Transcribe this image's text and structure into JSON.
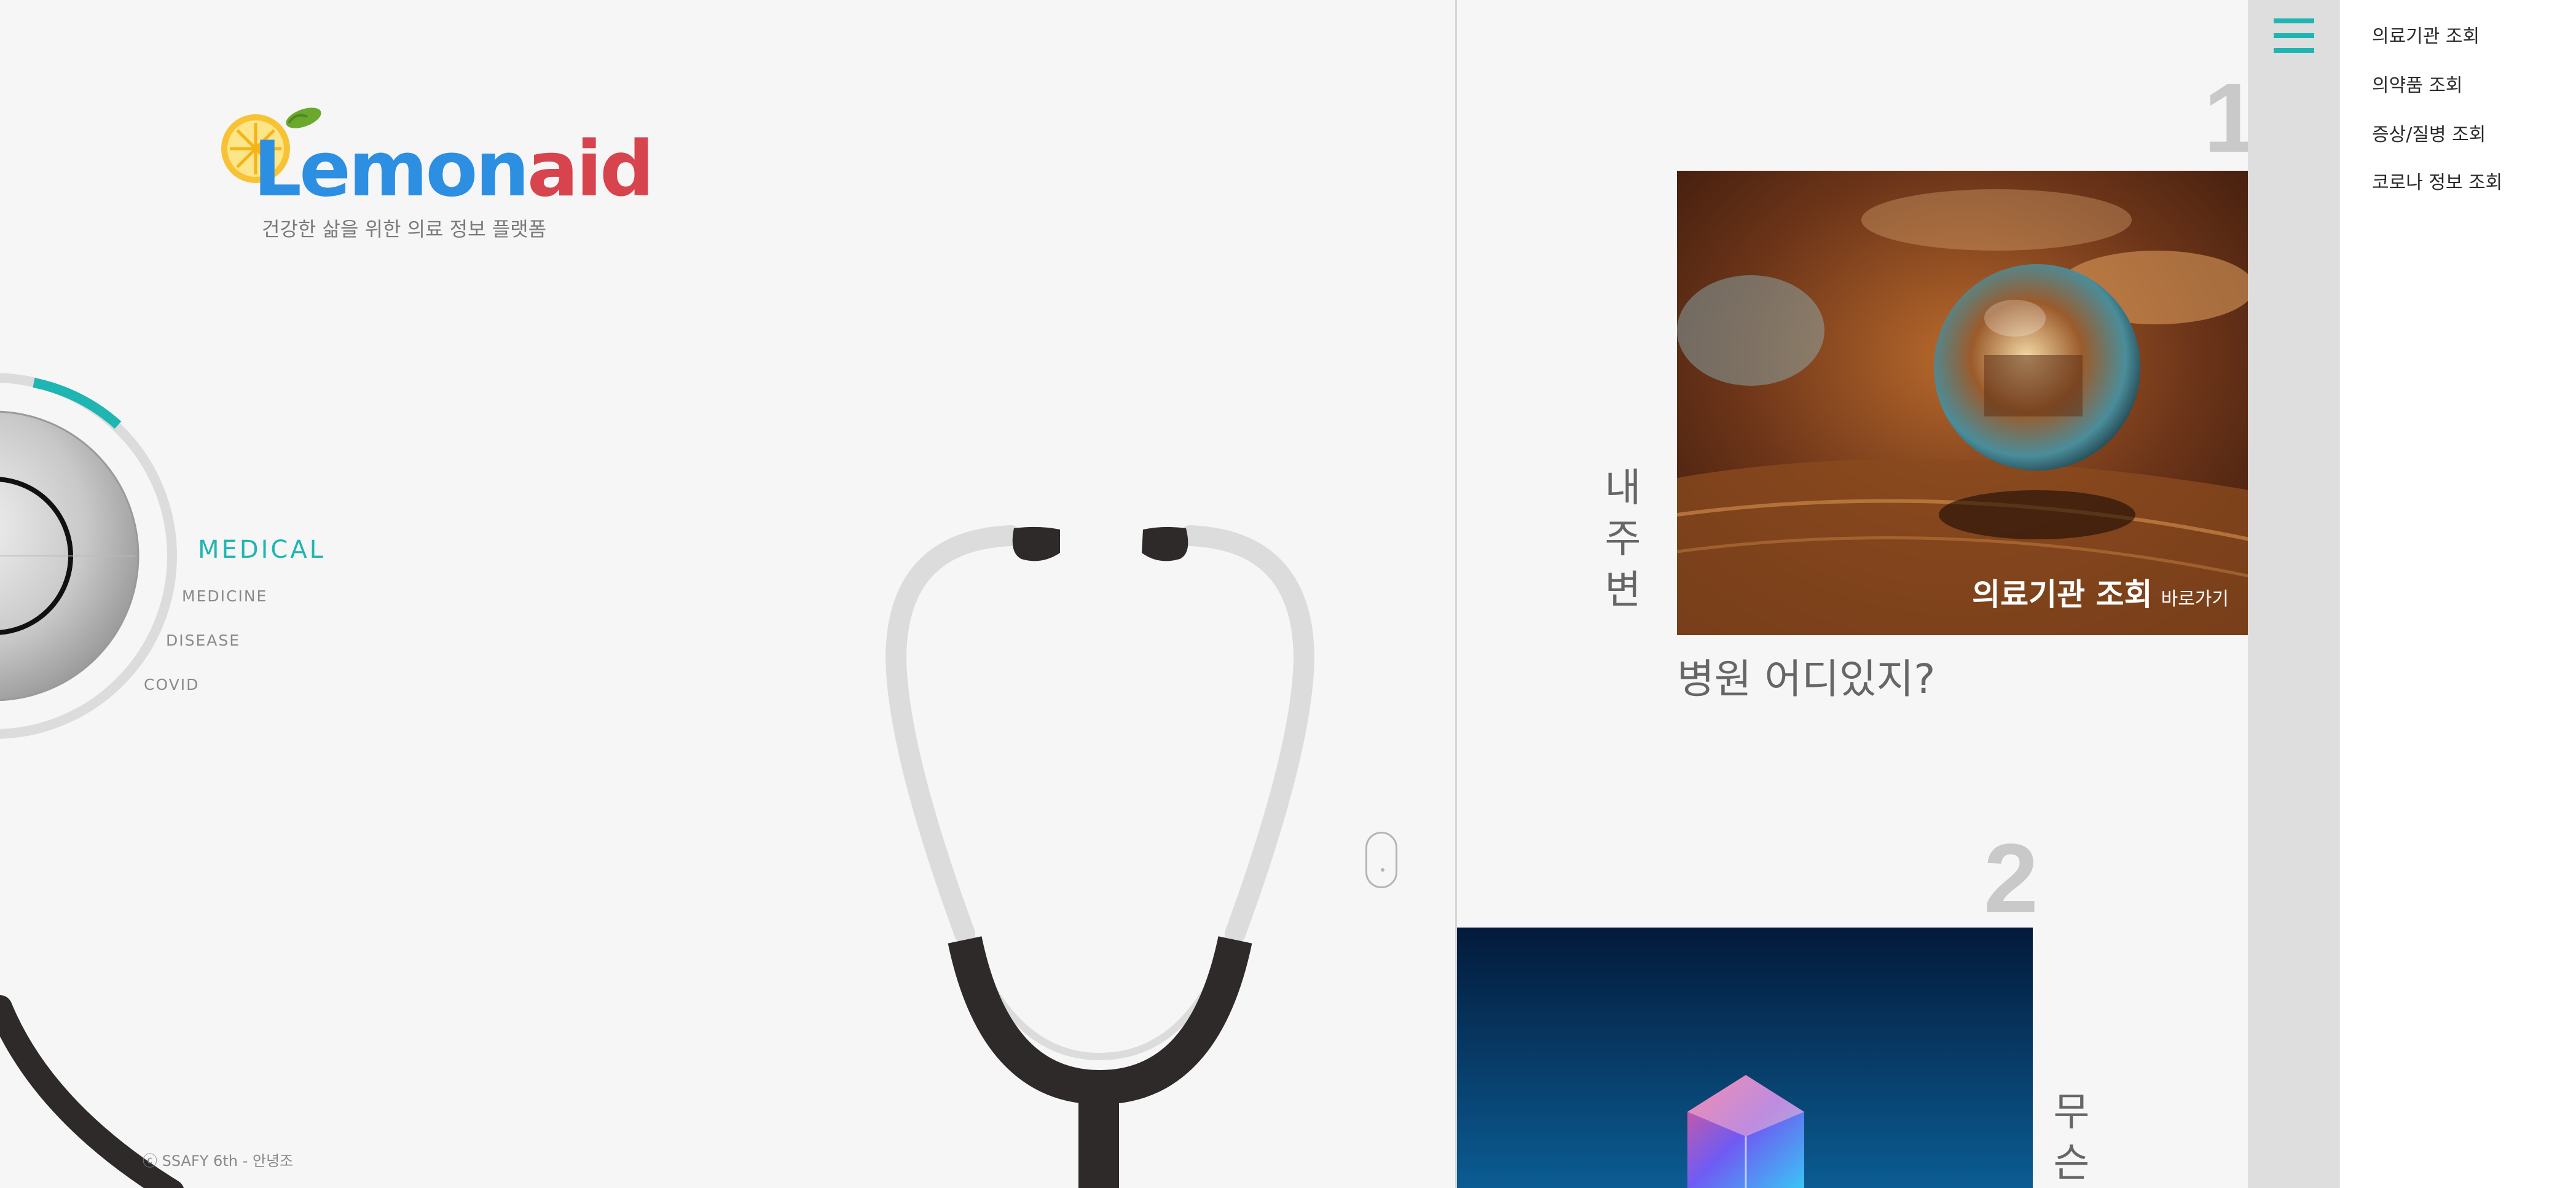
{
  "brand": {
    "wordmark_part1": "Lemon",
    "wordmark_part2": "aid",
    "tagline": "건강한 삶을 위한 의료 정보 플랫폼"
  },
  "hero_menu": {
    "active": "MEDICAL",
    "items": [
      "MEDICINE",
      "DISEASE",
      "COVID"
    ]
  },
  "copyright": "ⓒ SSAFY 6th - 안녕조",
  "cards": [
    {
      "number": "1",
      "title": "의료기관 조회",
      "link_label": "바로가기",
      "vertical_text": "내주변",
      "caption": "병원 어디있지?"
    },
    {
      "number": "2",
      "vertical_text": "무슨"
    }
  ],
  "nav": {
    "links": [
      "의료기관 조회",
      "의약품 조회",
      "증상/질병 조회",
      "코로나 정보 조회"
    ]
  },
  "colors": {
    "accent": "#1fb5b2",
    "logo_blue": "#2d8fe2",
    "logo_red": "#d8444d",
    "background": "#f6f6f6"
  },
  "icons": [
    "lemon-icon",
    "stethoscope-icon",
    "hamburger-icon",
    "mouse-scroll-icon"
  ]
}
